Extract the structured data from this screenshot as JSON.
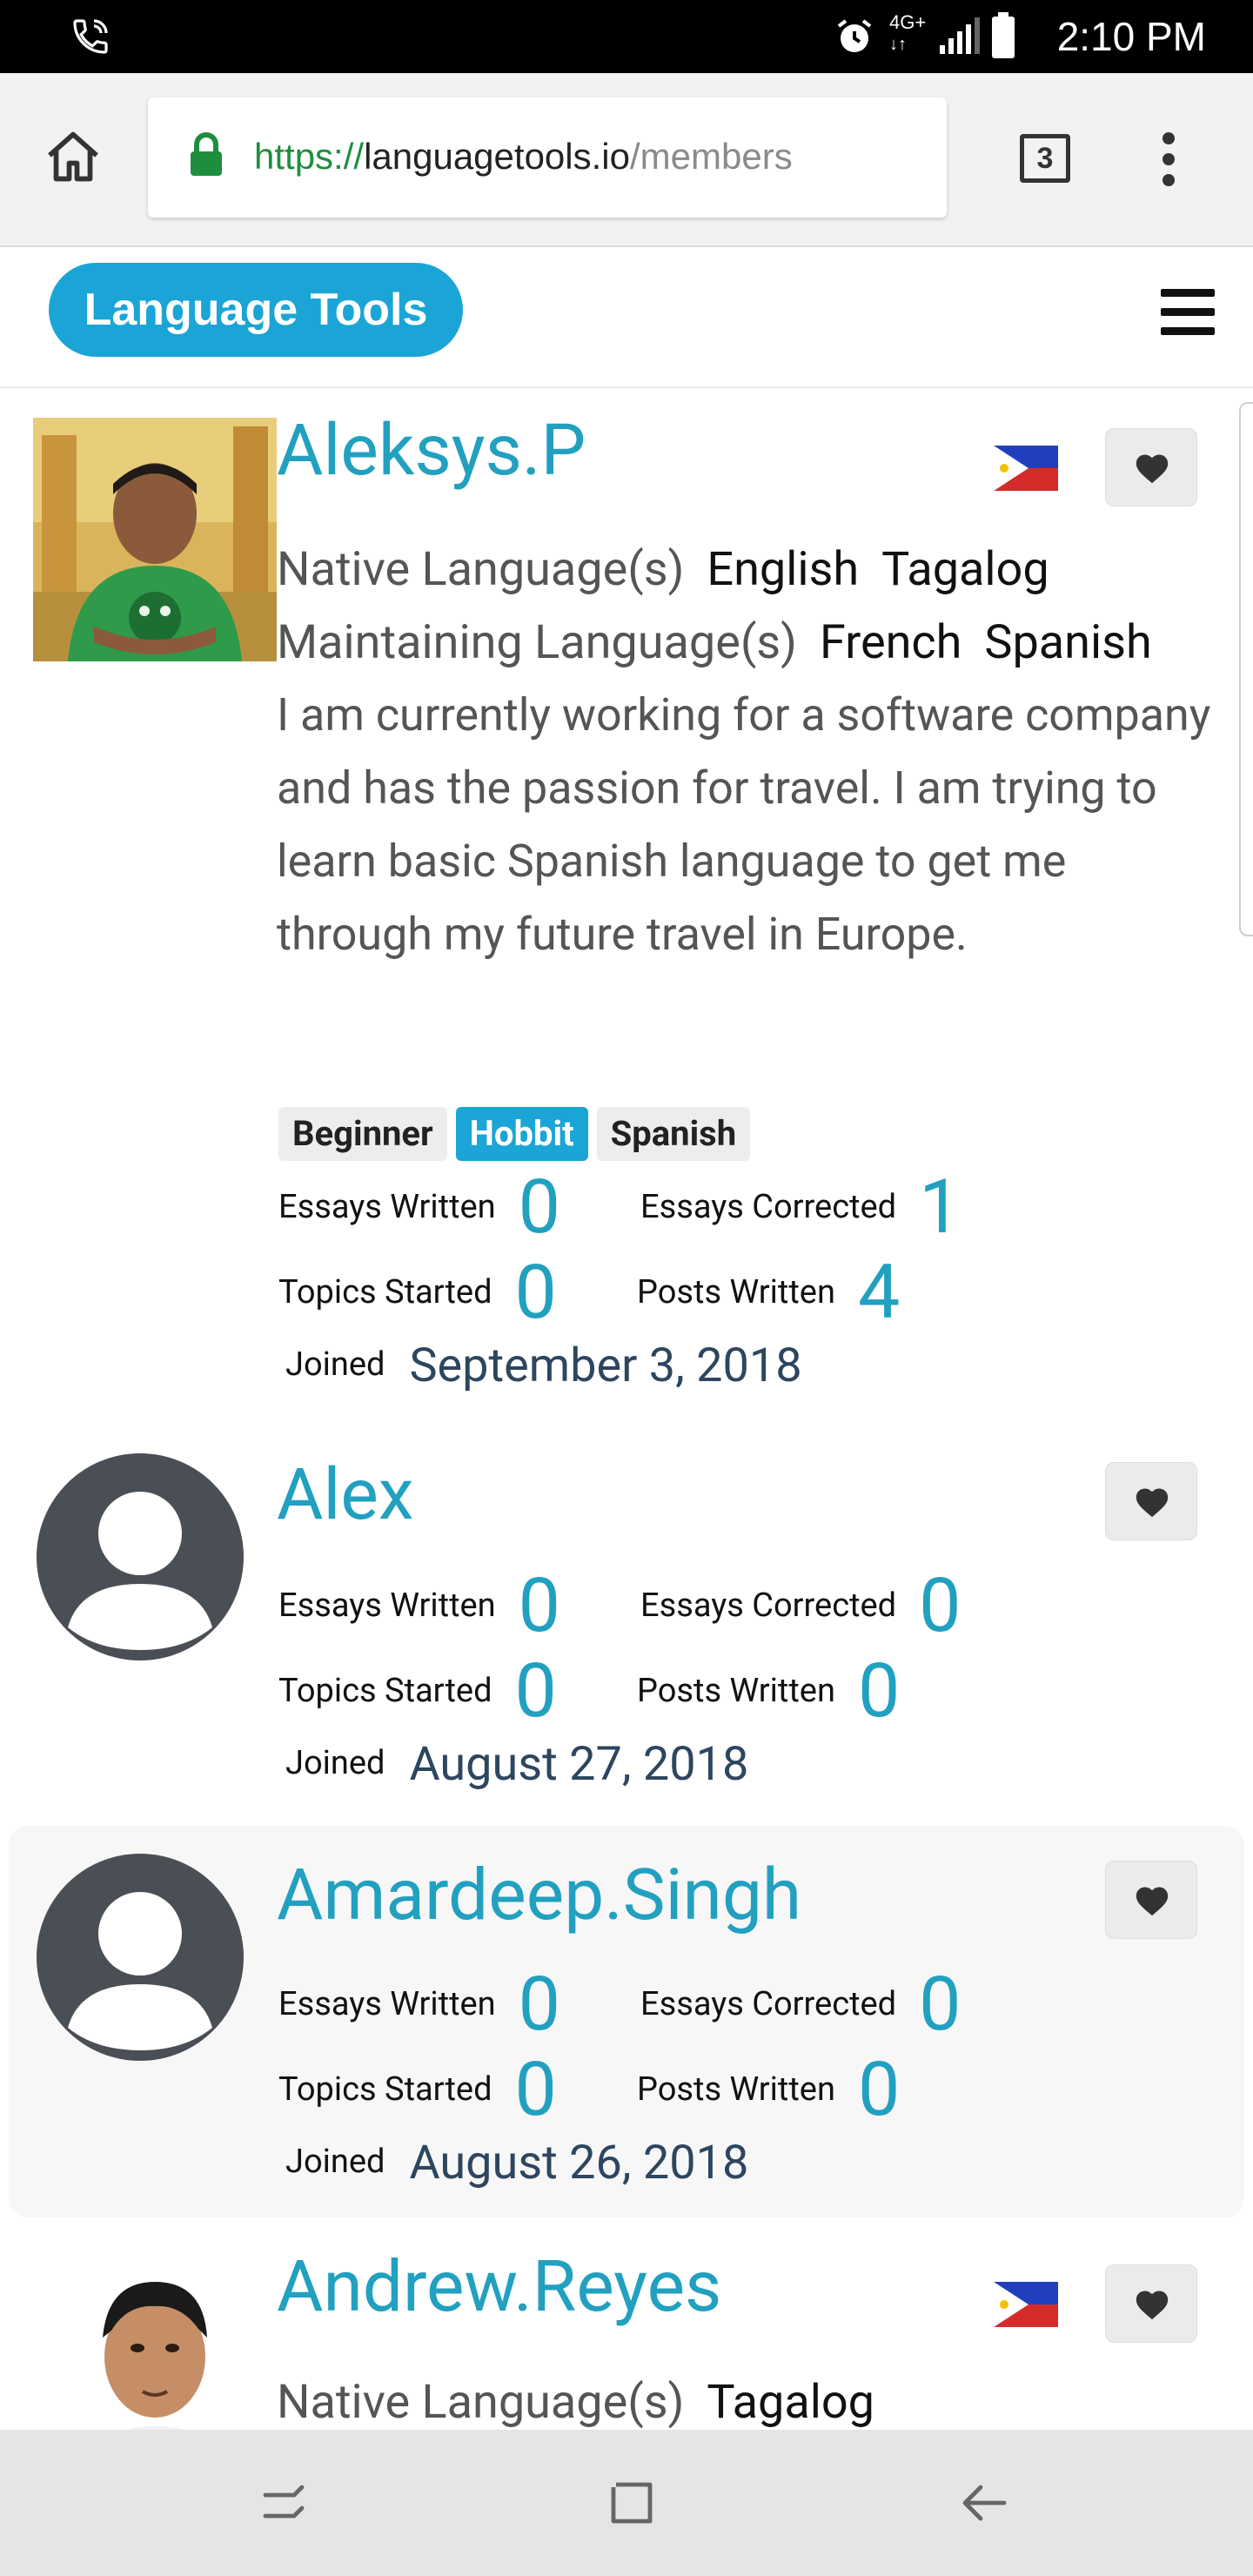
{
  "status_bar": {
    "time": "2:10 PM",
    "network": "4G+",
    "icons": [
      "phone-call-icon",
      "alarm-icon",
      "network-icon",
      "signal-icon",
      "battery-icon"
    ]
  },
  "browser": {
    "url_scheme": "https://",
    "url_domain": "languagetools.io",
    "url_path": "/members",
    "tab_count": "3",
    "icons": [
      "home-icon",
      "lock-icon",
      "tabs-icon",
      "more-vert-icon"
    ]
  },
  "site": {
    "brand": "Language Tools",
    "icons": [
      "menu-icon"
    ],
    "brand_color": "#1aa5d6"
  },
  "labels": {
    "native": "Native Language(s)",
    "maintaining": "Maintaining Language(s)",
    "essays_written": "Essays Written",
    "essays_corrected": "Essays Corrected",
    "topics_started": "Topics Started",
    "posts_written": "Posts Written",
    "joined": "Joined"
  },
  "members": [
    {
      "name": "Aleksys.P",
      "flag": "philippines-flag-icon",
      "native": [
        "English",
        "Tagalog"
      ],
      "maintaining": [
        "French",
        "Spanish"
      ],
      "bio": "I am currently working for a software company and has the passion for travel. I am trying to learn basic Spanish language to get me through my future travel in Europe.",
      "tags": [
        "Beginner",
        "Hobbit",
        "Spanish"
      ],
      "essays_written": "0",
      "essays_corrected": "1",
      "topics_started": "0",
      "posts_written": "4",
      "joined": "September 3, 2018"
    },
    {
      "name": "Alex",
      "essays_written": "0",
      "essays_corrected": "0",
      "topics_started": "0",
      "posts_written": "0",
      "joined": "August 27, 2018"
    },
    {
      "name": "Amardeep.Singh",
      "essays_written": "0",
      "essays_corrected": "0",
      "topics_started": "0",
      "posts_written": "0",
      "joined": "August 26, 2018"
    },
    {
      "name": "Andrew.Reyes",
      "flag": "philippines-flag-icon",
      "native": [
        "Tagalog"
      ]
    }
  ],
  "nav_bar": {
    "icons": [
      "recents-icon",
      "home-square-icon",
      "back-icon"
    ]
  },
  "colors": {
    "accent": "#22a0c0",
    "date": "#2d4660"
  }
}
